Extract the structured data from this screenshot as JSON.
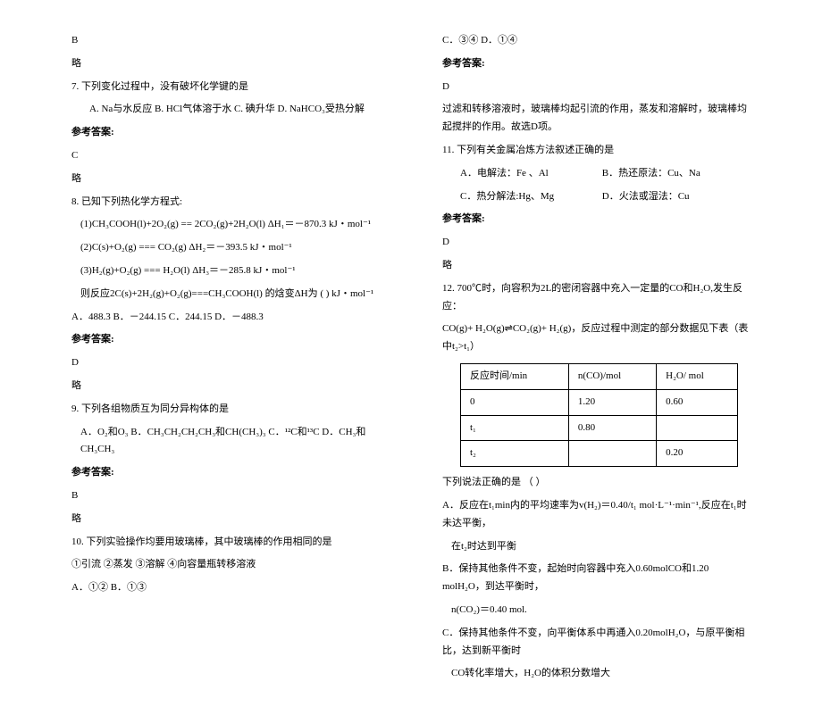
{
  "left": {
    "prev_ans": "B",
    "brief": "略",
    "q7": {
      "stem": "7. 下列变化过程中，没有破坏化学键的是",
      "opts": "A. Na与水反应    B. HCl气体溶于水    C. 碘升华   D. NaHCO₃受热分解",
      "ans_label": "参考答案:",
      "ans": "C",
      "brief": "略"
    },
    "q8": {
      "stem": "8. 已知下列热化学方程式:",
      "eq1": "(1)CH₃COOH(l)+2O₂(g) == 2CO₂(g)+2H₂O(l)       ΔH₁＝－870.3 kJ・mol⁻¹",
      "eq2": "(2)C(s)+O₂(g) === CO₂(g)                         ΔH₂＝－393.5 kJ・mol⁻¹",
      "eq3": "(3)H₂(g)+O₂(g) === H₂O(l)                        ΔH₃＝－285.8 kJ・mol⁻¹",
      "ask": "则反应2C(s)+2H₂(g)+O₂(g)===CH₃COOH(l) 的焓变ΔH为   (    ) kJ・mol⁻¹",
      "opts": "A．488.3      B．－244.15      C．244.15      D．－488.3",
      "ans_label": "参考答案:",
      "ans": "D",
      "brief": "略"
    },
    "q9": {
      "stem": "9. 下列各组物质互为同分异构体的是",
      "opts": "A．O₂和O₃   B．CH₃CH₂CH₂CH₃和CH(CH₃)₃   C．¹²C和¹³C   D．CH₃和CH₃CH₃",
      "ans_label": "参考答案:",
      "ans": "B",
      "brief": "略"
    },
    "q10": {
      "stem": "10. 下列实验操作均要用玻璃棒，其中玻璃棒的作用相同的是",
      "list": "①引流  ②蒸发  ③溶解  ④向容量瓶转移溶液",
      "opts": "A．①②    B．①③"
    }
  },
  "right": {
    "q10_more": "C．③④    D．①④",
    "q10_ans_label": "参考答案:",
    "q10_ans": "D",
    "q10_expl": "过滤和转移溶液时，玻璃棒均起引流的作用，蒸发和溶解时，玻璃棒均起搅拌的作用。故选D项。",
    "q11": {
      "stem": "11. 下列有关金属冶炼方法叙述正确的是",
      "optA": "A．电解法：Fe 、Al",
      "optB": "B．热还原法：Cu、Na",
      "optC": "C．热分解法:Hg、Mg",
      "optD": "D．火法或湿法：Cu",
      "ans_label": "参考答案:",
      "ans": "D",
      "brief": "略"
    },
    "q12": {
      "stem": "12. 700℃时，向容积为2L的密闭容器中充入一定量的CO和H₂O,发生反应：",
      "eq": "CO(g)+ H₂O(g)⇌CO₂(g)+ H₂(g)，反应过程中测定的部分数据见下表（表中t₂>t₁）",
      "table": {
        "h1": "反应时间/min",
        "h2": "n(CO)/mol",
        "h3": "H₂O/ mol",
        "r1c1": "0",
        "r1c2": "1.20",
        "r1c3": "0.60",
        "r2c1": "t₁",
        "r2c2": "0.80",
        "r2c3": "",
        "r3c1": "t₂",
        "r3c2": "",
        "r3c3": "0.20"
      },
      "ask": "下列说法正确的是  （   ）",
      "optA1": "A．反应在t₁min内的平均速率为v(H₂)＝0.40/t₁ mol·L⁻¹·min⁻¹,反应在t₁时未达平衡，",
      "optA2": "在t₂时达到平衡",
      "optB1": "B．保持其他条件不变，起始时向容器中充入0.60molCO和1.20 molH₂O，到达平衡时，",
      "optB2": "n(CO₂)＝0.40 mol.",
      "optC1": "C．保持其他条件不变，向平衡体系中再通入0.20molH₂O，与原平衡相比，达到新平衡时",
      "optC2": "CO转化率增大，H₂O的体积分数增大"
    }
  }
}
